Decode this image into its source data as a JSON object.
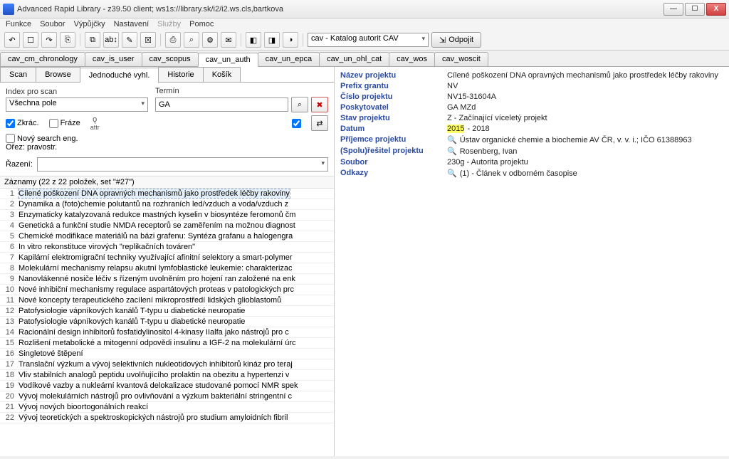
{
  "window": {
    "title": "Advanced Rapid Library - z39.50 client; ws1s://library.sk/i2/i2.ws.cls,bartkova"
  },
  "win_controls": {
    "min": "—",
    "max": "☐",
    "close": "X"
  },
  "menu": {
    "items": [
      "Funkce",
      "Soubor",
      "Výpůjčky",
      "Nastavení"
    ],
    "disabled": "Služby",
    "last": "Pomoc"
  },
  "toolbar": {
    "icons": [
      "↶",
      "☐",
      "↷",
      "⎘",
      "⧉",
      "ab↕",
      "✎",
      "☒",
      "⎙",
      "⌕",
      "⚙",
      "✉",
      "◧",
      "◨",
      "◑"
    ],
    "catalog": "cav - Katalog autorit CAV",
    "disconnect": "Odpojit",
    "disconnect_icon": "⇲"
  },
  "main_tabs": [
    "cav_cm_chronology",
    "cav_is_user",
    "cav_scopus",
    "cav_un_auth",
    "cav_un_epca",
    "cav_un_ohl_cat",
    "cav_wos",
    "cav_woscit"
  ],
  "main_tabs_active": 3,
  "subtabs": [
    "Scan",
    "Browse",
    "Jednoduché vyhl.",
    "Historie",
    "Košík"
  ],
  "subtabs_active": 2,
  "search": {
    "index_label": "Index pro scan",
    "index_value": "Všechna pole",
    "term_label": "Termín",
    "term_value": "GA",
    "zkrac": "Zkrác.",
    "fraze": "Fráze",
    "attr": "attr",
    "novy": "Nový search eng.",
    "orez": "Ořez: pravostr.",
    "search_icon": "⌕",
    "cancel_icon": "✖",
    "check_icon": "✔",
    "swap_icon": "⇄",
    "q_icon": "ǫ",
    "sort_label": "Řazení:",
    "sort_value": ""
  },
  "records": {
    "header": "Záznamy (22 z 22 položek, set \"#27\")",
    "items": [
      "Cílené poškození DNA opravných mechanismů jako prostředek léčby rakoviny",
      "Dynamika a (foto)chemie polutantů na rozhraních led/vzduch a voda/vzduch z",
      "Enzymaticky katalyzovaná redukce mastných kyselin v biosyntéze feromonů čm",
      "Genetická a funkční studie NMDA receptorů se zaměřením na možnou diagnost",
      "Chemické modifikace materiálů na bázi grafenu: Syntéza grafanu a halogengra",
      "In vitro rekonstituce virových \"replikačních továren\"",
      "Kapilární elektromigrační techniky využívající afinitní selektory a smart-polymer",
      "Molekulární mechanismy relapsu akutní lymfoblastické leukemie: charakterizac",
      "Nanovlákenné nosiče léčiv s řízeným uvolněním pro hojení ran založené na enk",
      "Nové inhibiční mechanismy regulace aspartátových proteas v patologických prc",
      "Nové koncepty terapeutického zacílení mikroprostředí lidských glioblastomů",
      "Patofysiologie vápníkových kanálů T-typu u diabetické neuropatie",
      "Patofysiologie vápníkových kanálů T-typu u diabetické neuropatie",
      "Racionální design inhibitorů fosfatidylinositol 4-kinasy IIalfa jako nástrojů pro c",
      "Rozlišení metabolické a mitogenní odpovědi insulinu a IGF-2 na molekulární úrc",
      "Singletové štěpení",
      "Translační výzkum a vývoj selektivních nukleotidových inhibitorů kináz pro teraj",
      "Vliv stabilních analogů peptidu uvolňujícího prolaktin na obezitu a hypertenzi v",
      "Vodíkové vazby a nukleární kvantová delokalizace studované pomocí NMR spek",
      "Vývoj molekulárních nástrojů pro ovlivňování a výzkum bakteriální stringentní c",
      "Vývoj nových bioortogonálních reakcí",
      "Vývoj teoretických a spektroskopických nástrojů pro studium amyloidních fibril"
    ]
  },
  "detail": {
    "fields": {
      "nazev_l": "Název projektu",
      "nazev_v": "Cílené poškození DNA opravných mechanismů jako prostředek léčby rakoviny",
      "prefix_l": "Prefix grantu",
      "prefix_v": "NV",
      "cislo_l": "Číslo projektu",
      "cislo_v": "NV15-31604A",
      "posk_l": "Poskytovatel",
      "posk_v": "GA MZd",
      "stav_l": "Stav projektu",
      "stav_v": "Z - Začínající víceletý projekt",
      "datum_l": "Datum",
      "datum_hl": "2015",
      "datum_rest": " - 2018",
      "prij_l": "Příjemce projektu",
      "prij_v": "Ústav organické chemie a biochemie AV ČR, v. v. i.; IČO 61388963",
      "res_l": "(Spolu)řešitel projektu",
      "res_v": "Rosenberg, Ivan",
      "soubor_l": "Soubor",
      "soubor_v": "230g - Autorita projektu",
      "odkazy_l": "Odkazy",
      "odkazy_v": "(1) - Článek v odborném časopise"
    }
  }
}
